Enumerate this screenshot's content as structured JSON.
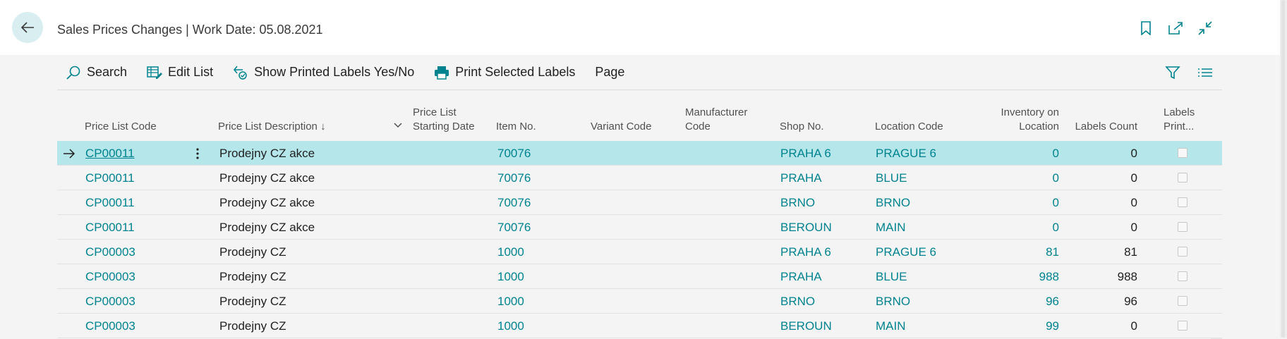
{
  "window": {
    "title": "Sales Prices Changes | Work Date: 05.08.2021"
  },
  "actions": {
    "search": "Search",
    "edit_list": "Edit List",
    "show_printed": "Show Printed Labels Yes/No",
    "print_selected": "Print Selected Labels",
    "page": "Page"
  },
  "columns": {
    "price_list_code": "Price List Code",
    "price_list_description": "Price List Description",
    "sort_indicator": "↓",
    "starting_date_l1": "Price List",
    "starting_date_l2": "Starting Date",
    "item_no": "Item No.",
    "variant_code": "Variant Code",
    "manufacturer_l1": "Manufacturer",
    "manufacturer_l2": "Code",
    "shop_no": "Shop No.",
    "location_code": "Location Code",
    "inventory_l1": "Inventory on",
    "inventory_l2": "Location",
    "labels_count": "Labels Count",
    "labels_printed_l1": "Labels",
    "labels_printed_l2": "Print..."
  },
  "rows": [
    {
      "code": "CP00011",
      "description": "Prodejny CZ akce",
      "item": "70076",
      "shop": "PRAHA 6",
      "location": "PRAGUE 6",
      "inventory": "0",
      "labels": "0",
      "printed": false
    },
    {
      "code": "CP00011",
      "description": "Prodejny CZ akce",
      "item": "70076",
      "shop": "PRAHA",
      "location": "BLUE",
      "inventory": "0",
      "labels": "0",
      "printed": false
    },
    {
      "code": "CP00011",
      "description": "Prodejny CZ akce",
      "item": "70076",
      "shop": "BRNO",
      "location": "BRNO",
      "inventory": "0",
      "labels": "0",
      "printed": false
    },
    {
      "code": "CP00011",
      "description": "Prodejny CZ akce",
      "item": "70076",
      "shop": "BEROUN",
      "location": "MAIN",
      "inventory": "0",
      "labels": "0",
      "printed": false
    },
    {
      "code": "CP00003",
      "description": "Prodejny CZ",
      "item": "1000",
      "shop": "PRAHA 6",
      "location": "PRAGUE 6",
      "inventory": "81",
      "labels": "81",
      "printed": false
    },
    {
      "code": "CP00003",
      "description": "Prodejny CZ",
      "item": "1000",
      "shop": "PRAHA",
      "location": "BLUE",
      "inventory": "988",
      "labels": "988",
      "printed": false
    },
    {
      "code": "CP00003",
      "description": "Prodejny CZ",
      "item": "1000",
      "shop": "BRNO",
      "location": "BRNO",
      "inventory": "96",
      "labels": "96",
      "printed": false
    },
    {
      "code": "CP00003",
      "description": "Prodejny CZ",
      "item": "1000",
      "shop": "BEROUN",
      "location": "MAIN",
      "inventory": "99",
      "labels": "0",
      "printed": false
    }
  ],
  "icons": {
    "back": "arrow-left-icon",
    "bookmark": "bookmark-icon",
    "open_new": "open-in-new-window-icon",
    "collapse": "collapse-icon",
    "search": "search-icon",
    "edit_list": "edit-list-icon",
    "show_printed": "toggle-filter-icon",
    "print": "printer-icon",
    "filter": "filter-icon",
    "list": "list-view-icon"
  },
  "colors": {
    "accent": "#00838f",
    "selected_row": "#b4e6ea",
    "back_button": "#d8eef0"
  }
}
